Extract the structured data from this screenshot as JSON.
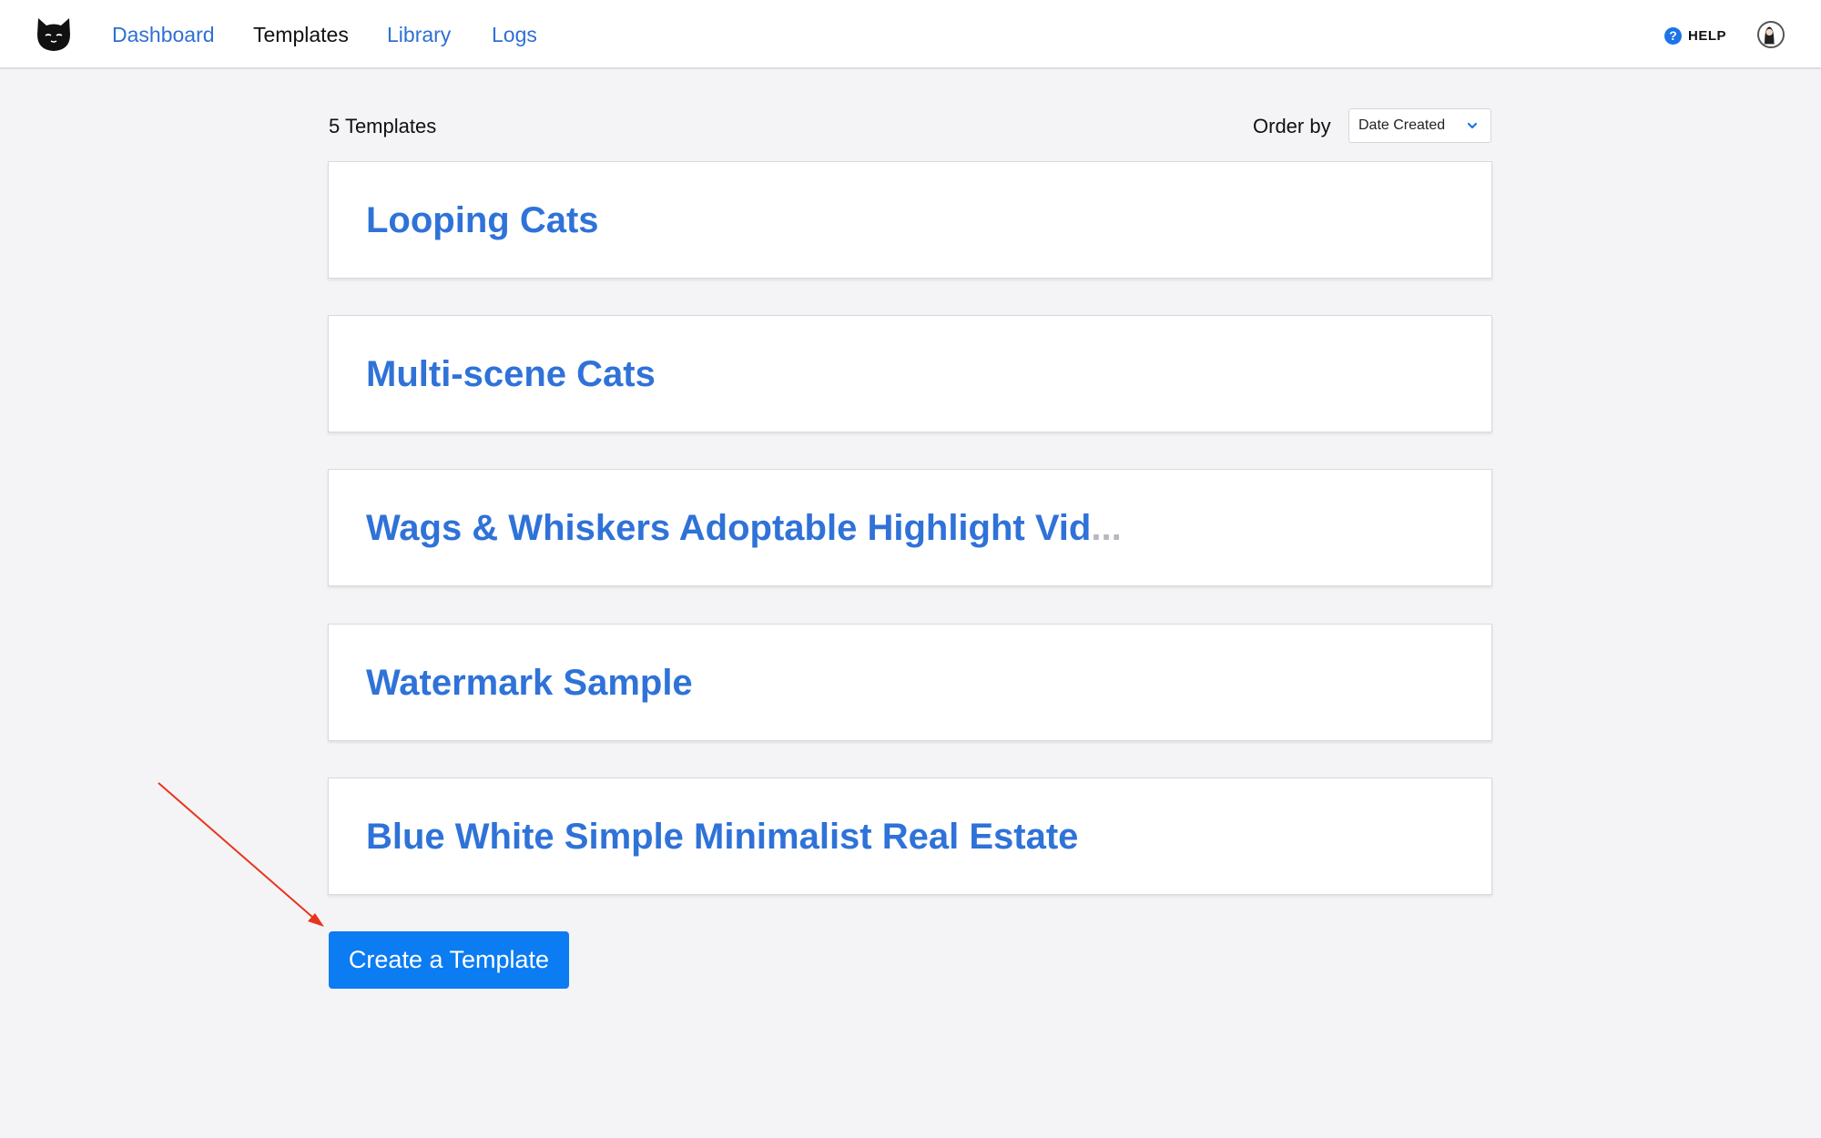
{
  "nav": {
    "items": [
      {
        "label": "Dashboard",
        "active": false
      },
      {
        "label": "Templates",
        "active": true
      },
      {
        "label": "Library",
        "active": false
      },
      {
        "label": "Logs",
        "active": false
      }
    ],
    "help_label": "HELP"
  },
  "templates": {
    "count_label": "5 Templates",
    "order_label": "Order by",
    "order_value": "Date Created",
    "items": [
      {
        "title": "Looping Cats"
      },
      {
        "title": "Multi-scene Cats"
      },
      {
        "title": "Wags & Whiskers Adoptable Highlight Vid",
        "ellipsis": "..."
      },
      {
        "title": "Watermark Sample"
      },
      {
        "title": "Blue White Simple Minimalist Real Estate"
      }
    ],
    "create_label": "Create a Template"
  },
  "colors": {
    "link": "#2f6fd6",
    "card_title": "#2f72d8",
    "primary_button": "#0b7cf2",
    "annotation_arrow": "#e8341c",
    "background": "#f4f4f6"
  },
  "icons": {
    "logo": "cat-logo-icon",
    "help": "help-circle-icon",
    "avatar": "user-avatar-icon",
    "dropdown": "chevron-down-icon",
    "annotation": "red-arrow-annotation"
  }
}
